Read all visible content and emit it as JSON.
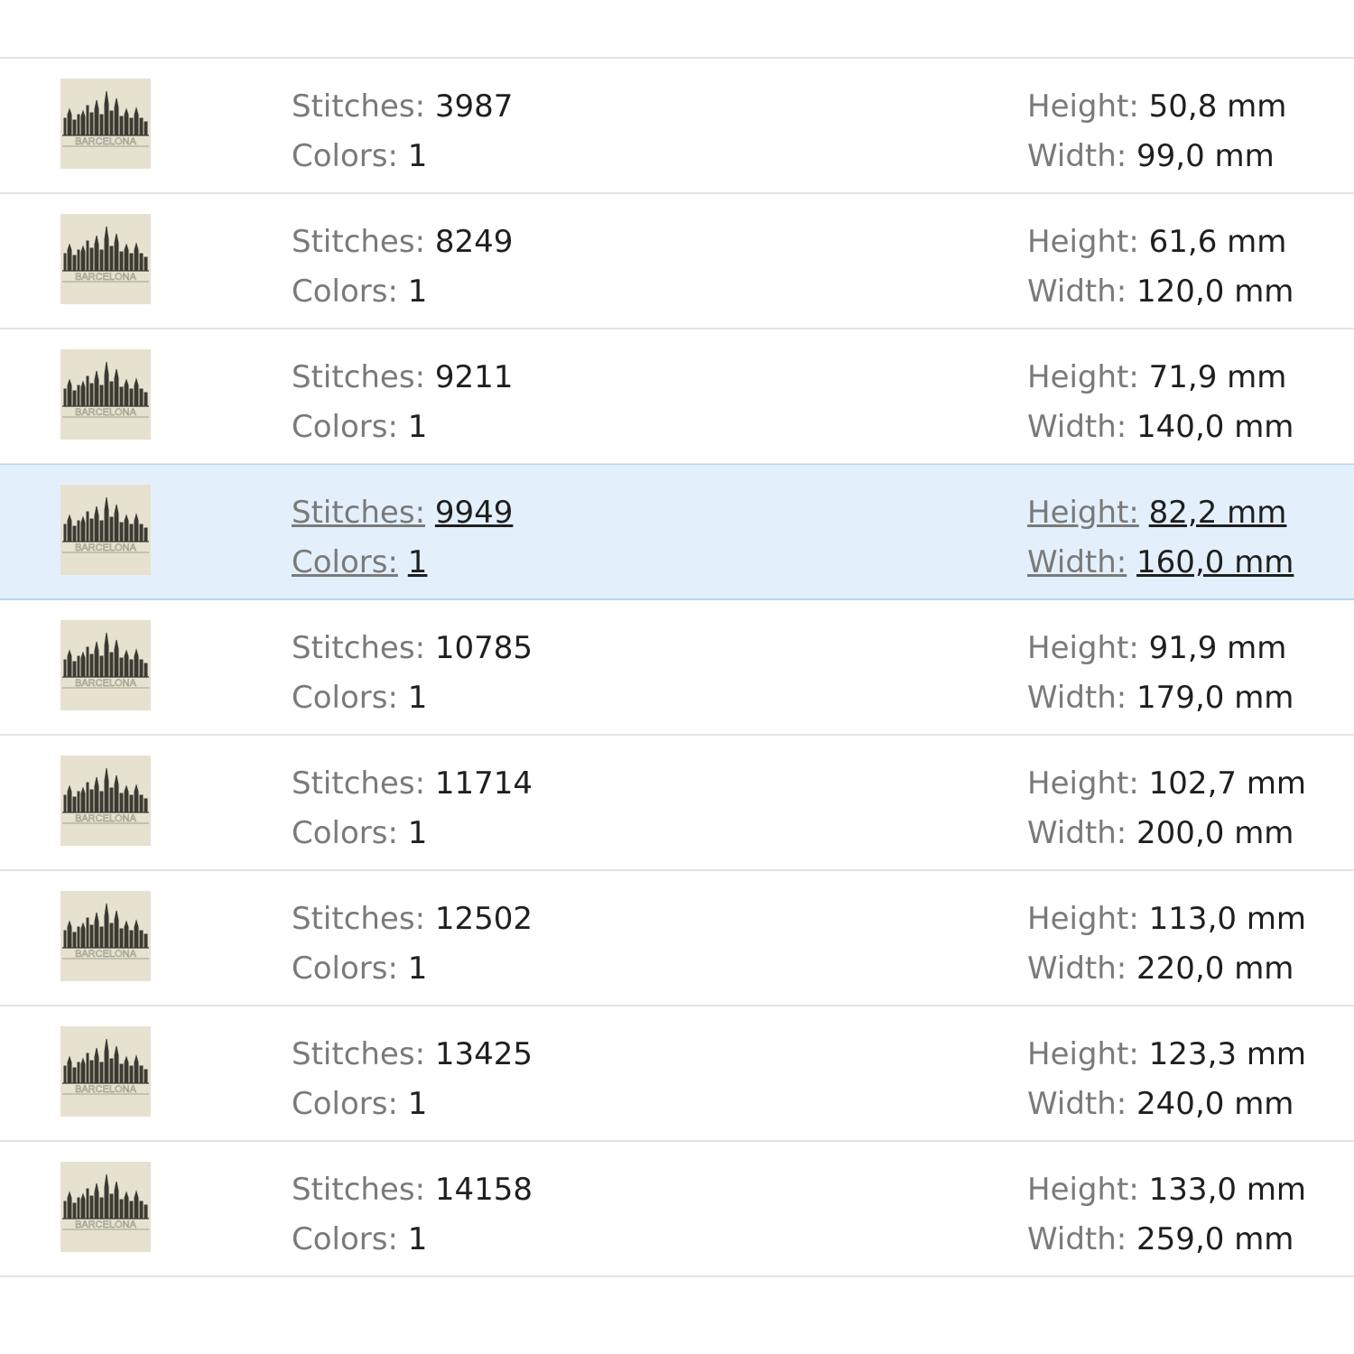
{
  "labels": {
    "stitches": "Stitches:",
    "colors": "Colors:",
    "height": "Height:",
    "width": "Width:"
  },
  "thumbnail": {
    "icon": "barcelona-skyline-design-thumbnail",
    "background": "#e6e2cf",
    "text": "BARCELONA"
  },
  "selected_index": 3,
  "colors": {
    "selected_background": "#e3f0fc",
    "divider": "#e4e4e4",
    "label_text": "#7a7a7a",
    "value_text": "#1f1f1f"
  },
  "designs": [
    {
      "stitches": "3987",
      "colors": "1",
      "height": "50,8 mm",
      "width": "99,0 mm"
    },
    {
      "stitches": "8249",
      "colors": "1",
      "height": "61,6 mm",
      "width": "120,0 mm"
    },
    {
      "stitches": "9211",
      "colors": "1",
      "height": "71,9 mm",
      "width": "140,0 mm"
    },
    {
      "stitches": "9949",
      "colors": "1",
      "height": "82,2 mm",
      "width": "160,0 mm"
    },
    {
      "stitches": "10785",
      "colors": "1",
      "height": "91,9 mm",
      "width": "179,0 mm"
    },
    {
      "stitches": "11714",
      "colors": "1",
      "height": "102,7 mm",
      "width": "200,0 mm"
    },
    {
      "stitches": "12502",
      "colors": "1",
      "height": "113,0 mm",
      "width": "220,0 mm"
    },
    {
      "stitches": "13425",
      "colors": "1",
      "height": "123,3 mm",
      "width": "240,0 mm"
    },
    {
      "stitches": "14158",
      "colors": "1",
      "height": "133,0 mm",
      "width": "259,0 mm"
    }
  ]
}
